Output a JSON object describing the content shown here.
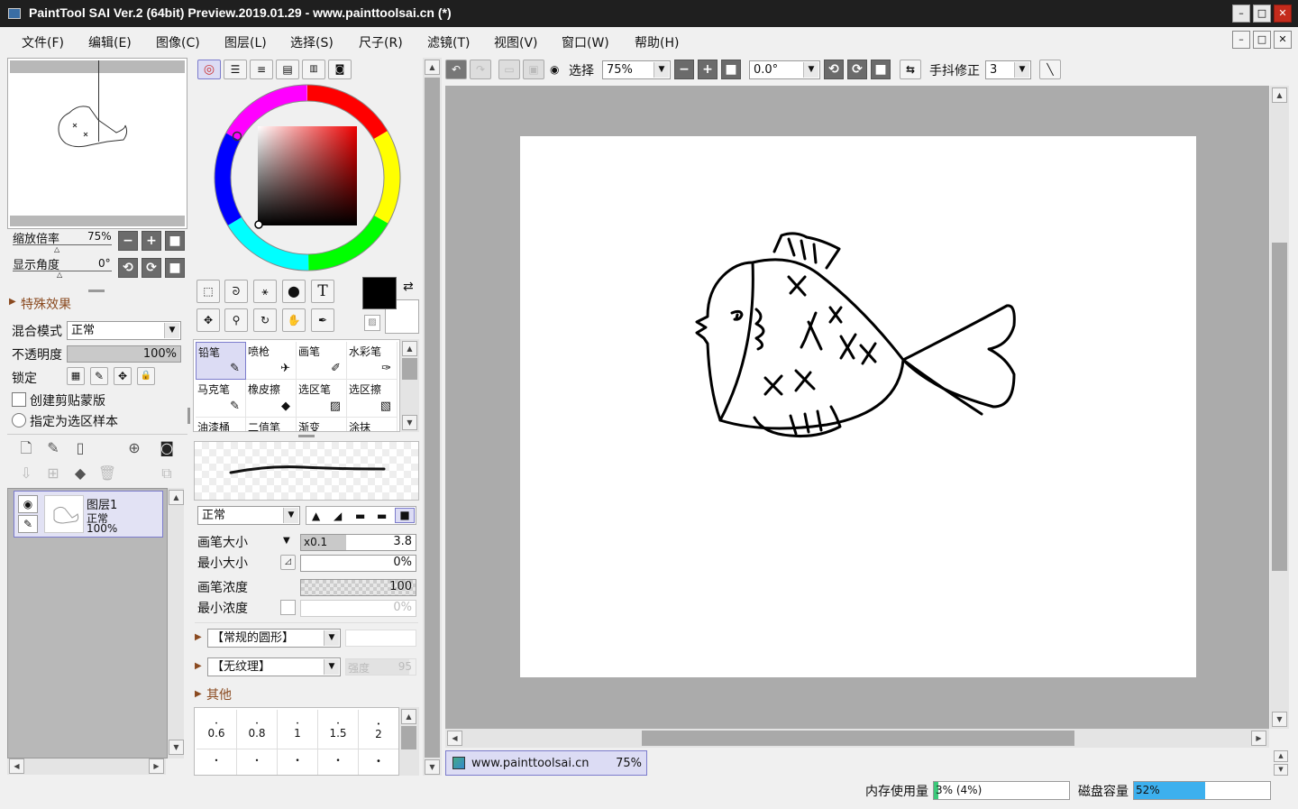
{
  "window": {
    "title": "PaintTool SAI Ver.2 (64bit) Preview.2019.01.29 - www.painttoolsai.cn (*)",
    "minimize": "–",
    "maximize": "□",
    "close": "✕"
  },
  "menu": [
    "文件(F)",
    "编辑(E)",
    "图像(C)",
    "图层(L)",
    "选择(S)",
    "尺子(R)",
    "滤镜(T)",
    "视图(V)",
    "窗口(W)",
    "帮助(H)"
  ],
  "navigator": {
    "zoom_label": "缩放倍率",
    "zoom_value": "75%",
    "angle_label": "显示角度",
    "angle_value": "0°"
  },
  "layer_props": {
    "effects_label": "特殊效果",
    "blend_label": "混合模式",
    "blend_value": "正常",
    "opacity_label": "不透明度",
    "opacity_value": "100%",
    "opacity_fraction": 1.0,
    "lock_label": "锁定",
    "clip_label": "创建剪贴蒙版",
    "sample_label": "指定为选区样本"
  },
  "layers": [
    {
      "name": "图层1",
      "mode": "正常",
      "opacity": "100%"
    }
  ],
  "color": {
    "hue_handle": "#e87e7e",
    "current_fg": "#000000",
    "current_bg": "#ffffff"
  },
  "brushes": [
    "铅笔",
    "喷枪",
    "画笔",
    "水彩笔",
    "马克笔",
    "橡皮擦",
    "选区笔",
    "选区擦",
    "油漆桶",
    "二值笔",
    "渐变",
    "涂抹"
  ],
  "brush_settings": {
    "mode_value": "正常",
    "size_label": "画笔大小",
    "size_mult": "x0.1",
    "size_value": "3.8",
    "min_size_label": "最小大小",
    "min_size_value": "0%",
    "density_label": "画笔浓度",
    "density_value": "100",
    "min_density_label": "最小浓度",
    "min_density_value": "0%",
    "shape_value": "【常规的圆形】",
    "texture_value": "【无纹理】",
    "texture_strength_label": "强度",
    "texture_strength_value": "95",
    "other_label": "其他"
  },
  "size_presets": [
    "0.6",
    "0.8",
    "1",
    "1.5",
    "2"
  ],
  "toolbar": {
    "select_label": "选择",
    "zoom_value": "75%",
    "angle_value": "0.0°",
    "stabilizer_label": "手抖修正",
    "stabilizer_value": "3"
  },
  "doc_tab": {
    "name": "www.painttoolsai.cn",
    "zoom": "75%"
  },
  "status": {
    "memory_label": "内存使用量",
    "memory_value": "3% (4%)",
    "memory_fraction": 0.03,
    "disk_label": "磁盘容量",
    "disk_value": "52%",
    "disk_fraction": 0.52
  }
}
